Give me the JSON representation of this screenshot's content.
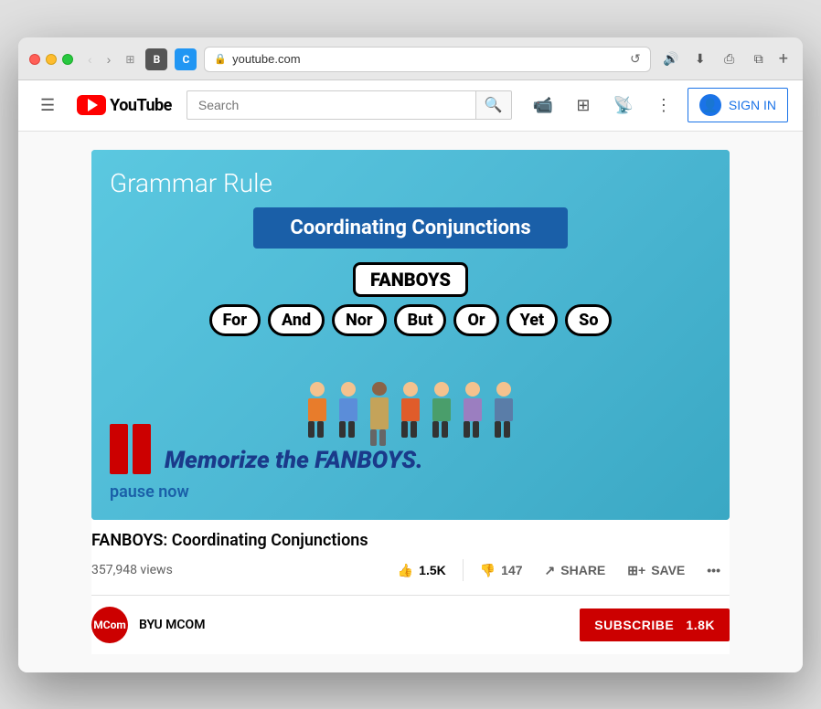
{
  "browser": {
    "url": "youtube.com",
    "url_display": "🔒 youtube.com",
    "new_tab_label": "+"
  },
  "header": {
    "menu_icon": "☰",
    "logo_text": "YouTube",
    "search_placeholder": "Search",
    "sign_in_label": "SIGN IN",
    "upload_icon": "📹",
    "apps_icon": "⊞",
    "notifications_icon": "🔔",
    "more_icon": "⋮"
  },
  "video": {
    "title": "FANBOYS: Coordinating Conjunctions",
    "views": "357,948 views",
    "grammar_rule_label": "Grammar Rule",
    "banner_text": "Coordinating Conjunctions",
    "fanboys_label": "FANBOYS",
    "fanboys_words": [
      "For",
      "And",
      "Nor",
      "But",
      "Or",
      "Yet",
      "So"
    ],
    "memorize_text": "Memorize the FANBOYS.",
    "pause_text": "pause now",
    "like_count": "1.5K",
    "dislike_count": "147",
    "share_label": "SHARE",
    "save_label": "SAVE",
    "more_label": "•••"
  },
  "channel": {
    "avatar_text": "MCom",
    "name": "BYU MCOM",
    "subscribe_label": "SUBSCRIBE",
    "subscriber_count": "1.8K"
  }
}
